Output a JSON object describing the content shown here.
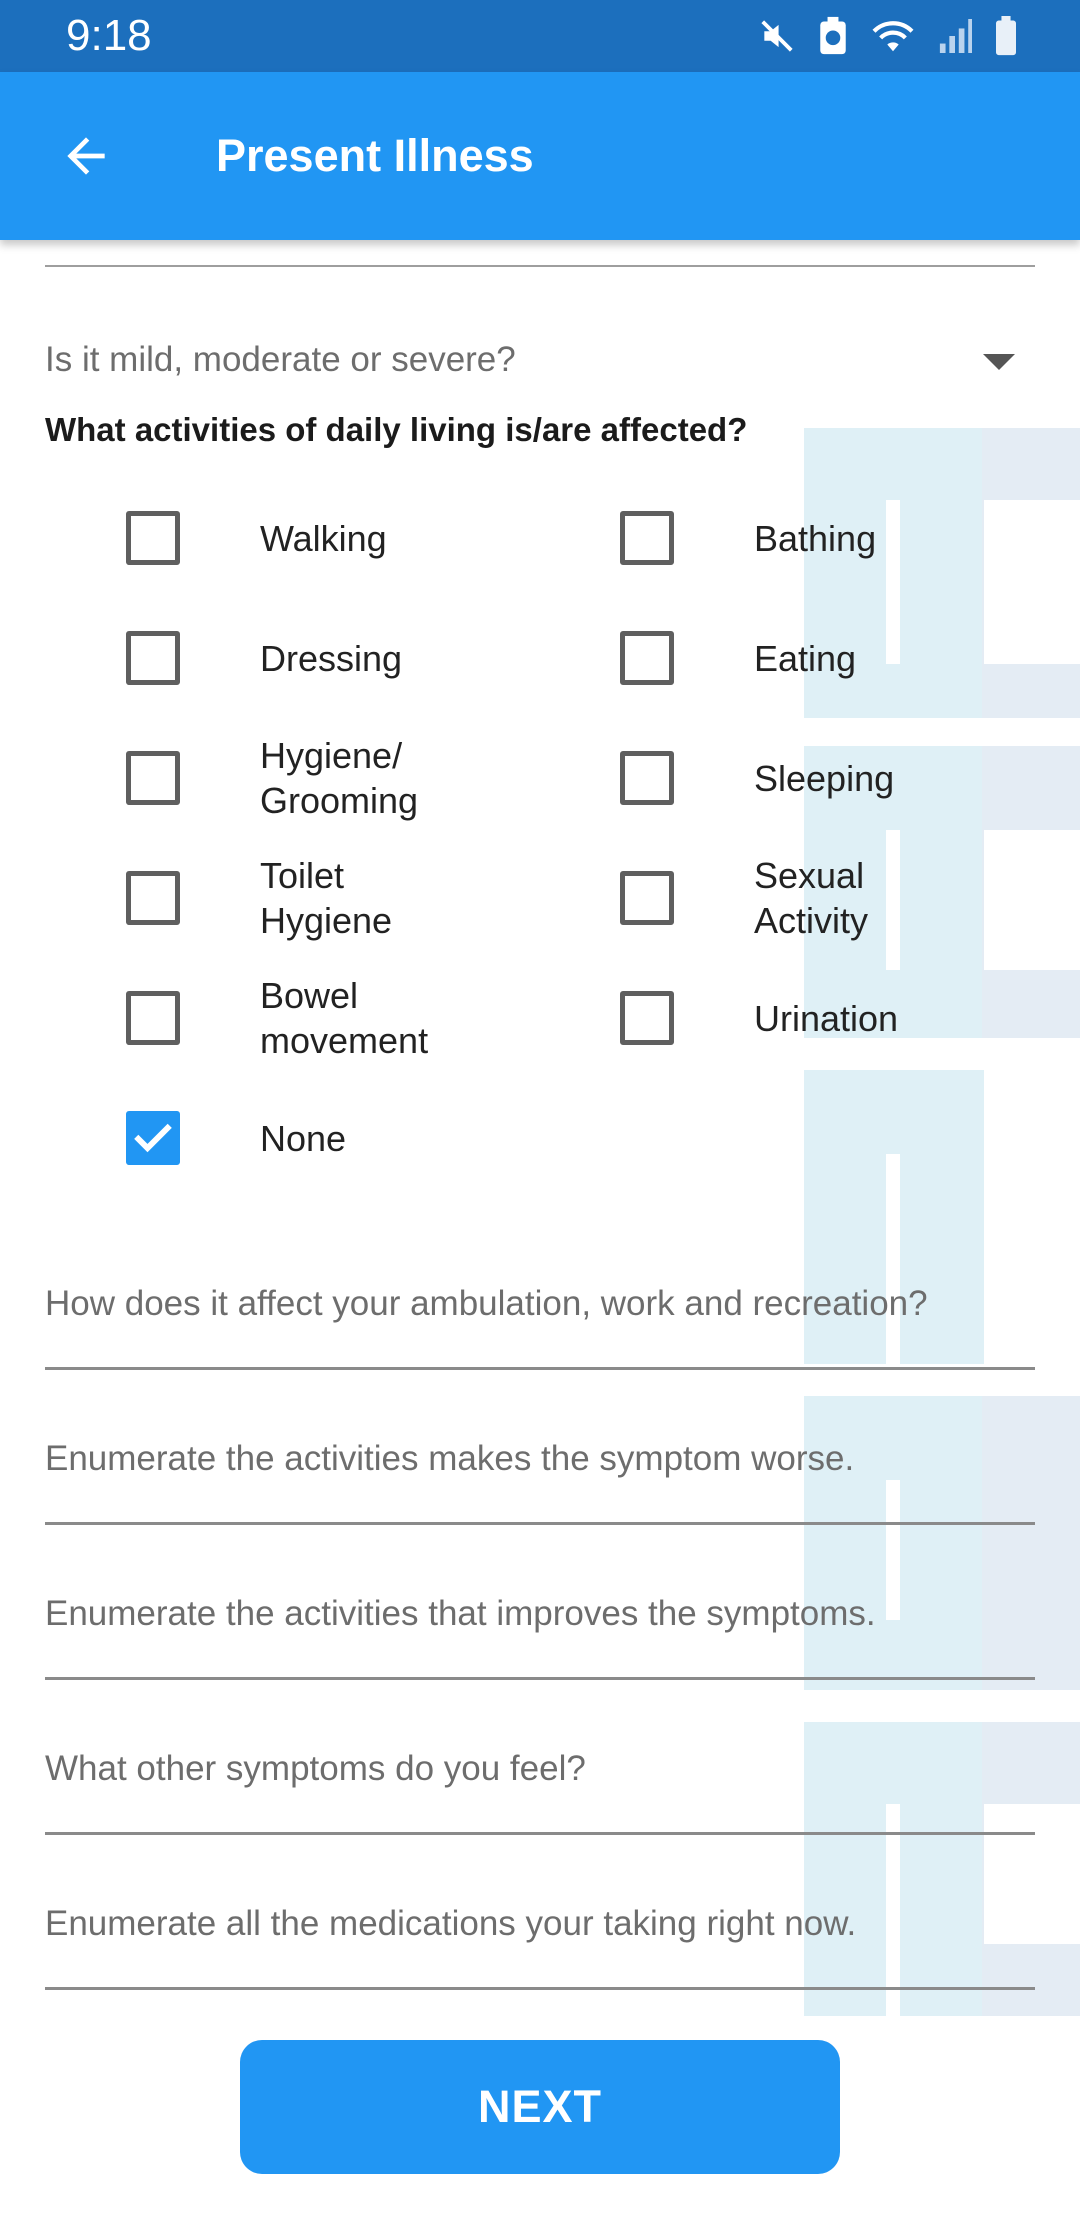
{
  "status_bar": {
    "time": "9:18",
    "icons": [
      "mute-icon",
      "battery-saver-icon",
      "wifi-icon",
      "signal-icon",
      "battery-icon"
    ]
  },
  "app_bar": {
    "title": "Present Illness",
    "back_icon": "arrow-left-icon"
  },
  "colors": {
    "primary": "#2196f3",
    "status_bar": "#1c6fbd",
    "checkbox_checked": "#2196f3"
  },
  "severity_dropdown": {
    "placeholder": "Is it mild, moderate or severe?",
    "icon": "dropdown-arrow-icon"
  },
  "activities": {
    "question": "What activities of daily living is/are affected?",
    "options": [
      {
        "label": "Walking",
        "checked": false
      },
      {
        "label": "Bathing",
        "checked": false
      },
      {
        "label": "Dressing",
        "checked": false
      },
      {
        "label": "Eating",
        "checked": false
      },
      {
        "label": "Hygiene/\nGrooming",
        "checked": false
      },
      {
        "label": "Sleeping",
        "checked": false
      },
      {
        "label": "Toilet\nHygiene",
        "checked": false
      },
      {
        "label": "Sexual\nActivity",
        "checked": false
      },
      {
        "label": "Bowel\nmovement",
        "checked": false
      },
      {
        "label": "Urination",
        "checked": false
      },
      {
        "label": "None",
        "checked": true
      }
    ]
  },
  "fields": [
    {
      "placeholder": "How does it affect your ambulation, work and recreation?",
      "value": ""
    },
    {
      "placeholder": "Enumerate the activities makes the symptom worse.",
      "value": ""
    },
    {
      "placeholder": "Enumerate the activities that improves the symptoms.",
      "value": ""
    },
    {
      "placeholder": "What other symptoms do you feel?",
      "value": ""
    },
    {
      "placeholder": "Enumerate all the medications your taking right now.",
      "value": ""
    }
  ],
  "next_button": {
    "label": "NEXT"
  }
}
